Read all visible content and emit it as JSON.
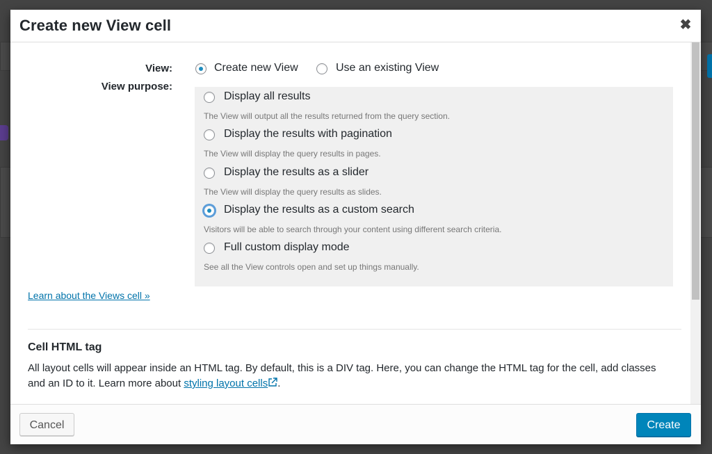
{
  "dialog": {
    "title": "Create new View cell",
    "close_symbol": "✖"
  },
  "view_field": {
    "label": "View:",
    "options": [
      {
        "label": "Create new View",
        "checked": true
      },
      {
        "label": "Use an existing View",
        "checked": false
      }
    ]
  },
  "purpose_field": {
    "label": "View purpose:",
    "options": [
      {
        "label": "Display all results",
        "description": "The View will output all the results returned from the query section.",
        "checked": false
      },
      {
        "label": "Display the results with pagination",
        "description": "The View will display the query results in pages.",
        "checked": false
      },
      {
        "label": "Display the results as a slider",
        "description": "The View will display the query results as slides.",
        "checked": false
      },
      {
        "label": "Display the results as a custom search",
        "description": "Visitors will be able to search through your content using different search criteria.",
        "checked": true
      },
      {
        "label": "Full custom display mode",
        "description": "See all the View controls open and set up things manually.",
        "checked": false
      }
    ]
  },
  "learn_link": "Learn about the Views cell »",
  "html_tag_section": {
    "title": "Cell HTML tag",
    "text_before": "All layout cells will appear inside an HTML tag. By default, this is a DIV tag. Here, you can change the HTML tag for the cell, add classes and an ID to it. Learn more about ",
    "link_text": "styling layout cells",
    "text_after": "."
  },
  "footer": {
    "cancel_label": "Cancel",
    "create_label": "Create"
  },
  "colors": {
    "primary": "#0085ba",
    "link": "#0073aa",
    "radio_checked": "#1e8cbe"
  }
}
